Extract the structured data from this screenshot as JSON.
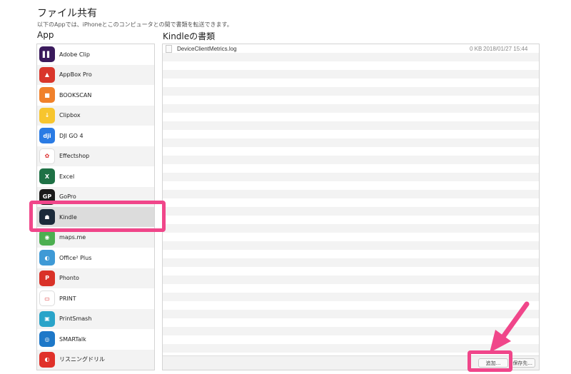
{
  "header": {
    "title": "ファイル共有",
    "subtitle": "以下のAppでは、iPhoneとこのコンピュータとの間で書類を転送できます。"
  },
  "apps_panel": {
    "heading": "App",
    "selected": "Kindle",
    "items": [
      {
        "label": "Adobe Clip",
        "icon": "adobe-clip-icon",
        "color": "#3a1a5c",
        "glyph": "▌▌"
      },
      {
        "label": "AppBox Pro",
        "icon": "appbox-pro-icon",
        "color": "#d9362b",
        "glyph": "▲"
      },
      {
        "label": "BOOKSCAN",
        "icon": "bookscan-icon",
        "color": "#f0812b",
        "glyph": "■"
      },
      {
        "label": "Clipbox",
        "icon": "clipbox-icon",
        "color": "#f7c52e",
        "glyph": "↓"
      },
      {
        "label": "DJI GO 4",
        "icon": "dji-go-icon",
        "color": "#2a7be4",
        "glyph": "dji"
      },
      {
        "label": "Effectshop",
        "icon": "effectshop-icon",
        "color": "#ffffff",
        "glyph": "✿"
      },
      {
        "label": "Excel",
        "icon": "excel-icon",
        "color": "#1e7145",
        "glyph": "X"
      },
      {
        "label": "GoPro",
        "icon": "gopro-icon",
        "color": "#1a1a1a",
        "glyph": "GP"
      },
      {
        "label": "Kindle",
        "icon": "kindle-icon",
        "color": "#1b2a3a",
        "glyph": "☗"
      },
      {
        "label": "maps.me",
        "icon": "maps-me-icon",
        "color": "#4caf50",
        "glyph": "◉"
      },
      {
        "label": "Office² Plus",
        "icon": "office-plus-icon",
        "color": "#3f9ad6",
        "glyph": "◐"
      },
      {
        "label": "Phonto",
        "icon": "phonto-icon",
        "color": "#d93228",
        "glyph": "P"
      },
      {
        "label": "PRINT",
        "icon": "canon-print-icon",
        "color": "#ffffff",
        "glyph": "▭"
      },
      {
        "label": "PrintSmash",
        "icon": "printsmash-icon",
        "color": "#2aa4c9",
        "glyph": "▣"
      },
      {
        "label": "SMARTalk",
        "icon": "smartalk-icon",
        "color": "#1e78c8",
        "glyph": "◎"
      },
      {
        "label": "リスニングドリル",
        "icon": "listening-drill-icon",
        "color": "#e0312a",
        "glyph": "◐"
      }
    ]
  },
  "docs_panel": {
    "heading": "Kindleの書類",
    "files": [
      {
        "name": "DeviceClientMetrics.log",
        "size": "0 KB",
        "date": "2018/01/27 15:44"
      }
    ],
    "add_button": "追加...",
    "save_button": "保存先..."
  }
}
